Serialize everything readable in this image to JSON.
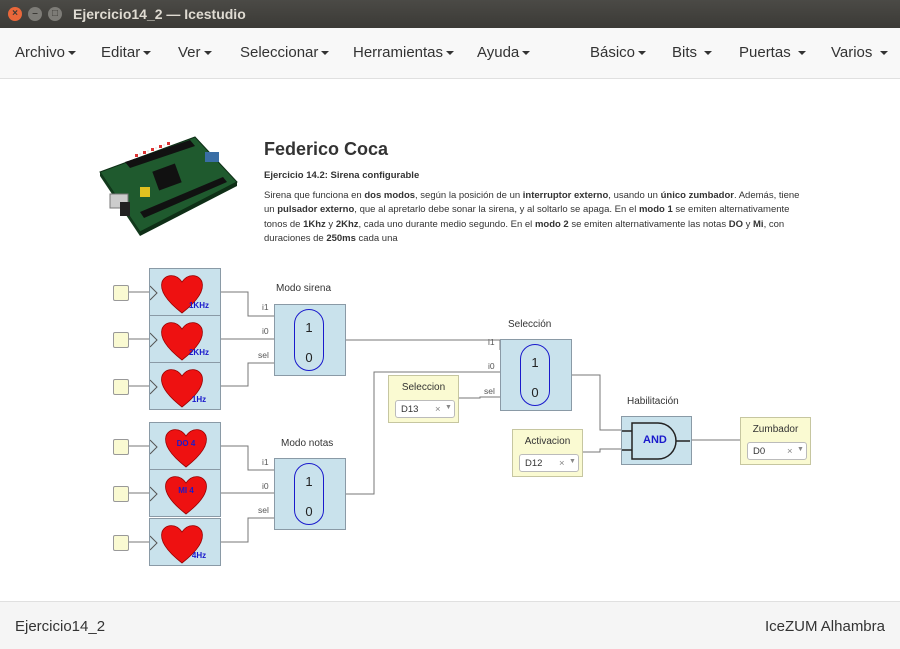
{
  "window": {
    "title": "Ejercicio14_2 — Icestudio"
  },
  "menu_left": [
    "Archivo",
    "Editar",
    "Ver",
    "Seleccionar",
    "Herramientas",
    "Ayuda"
  ],
  "menu_right": [
    "Básico",
    "Bits",
    "Puertas",
    "Varios"
  ],
  "info": {
    "author": "Federico Coca",
    "subtitle": "Ejercicio 14.2: Sirena configurable",
    "description": "Sirena que funciona en dos modos, según la posición de un interruptor externo, usando un único zumbador. Además, tiene un pulsador externo, que al apretarlo debe sonar la sirena, y al soltarlo se apaga. En el modo 1 se emiten alternativamente tonos de 1Khz y 2Khz, cada uno durante medio segundo. En el modo 2 se emiten alternativamente las notas DO y Mi, con duraciones de 250ms cada una"
  },
  "hearts": [
    {
      "label": "1KHz"
    },
    {
      "label": "2KHz"
    },
    {
      "label": "1Hz"
    },
    {
      "label": "DO 4"
    },
    {
      "label": "MI 4"
    },
    {
      "label": "4Hz"
    }
  ],
  "mux_sirena": {
    "title": "Modo sirena",
    "top_value": "1",
    "bottom_value": "0",
    "ports": [
      "i1",
      "i0",
      "sel"
    ]
  },
  "mux_notas": {
    "title": "Modo notas",
    "top_value": "1",
    "bottom_value": "0",
    "ports": [
      "i1",
      "i0",
      "sel"
    ]
  },
  "mux_seleccion": {
    "title": "Selección",
    "top_value": "1",
    "bottom_value": "0",
    "ports": [
      "i1",
      "i0",
      "sel"
    ]
  },
  "and_gate": {
    "title": "Habilitación",
    "label": "AND"
  },
  "inputs": [
    {
      "title": "Seleccion",
      "value": "D13"
    },
    {
      "title": "Activacion",
      "value": "D12"
    }
  ],
  "output": {
    "title": "Zumbador",
    "value": "D0"
  },
  "select_clear": "×",
  "select_arrow": "▼",
  "footer": {
    "left": "Ejercicio14_2",
    "right": "IceZUM Alhambra"
  },
  "colors": {
    "block": "#c9e2ec",
    "pin": "#fafad2",
    "heart": "#ee1111",
    "accent": "#1a1acc"
  }
}
